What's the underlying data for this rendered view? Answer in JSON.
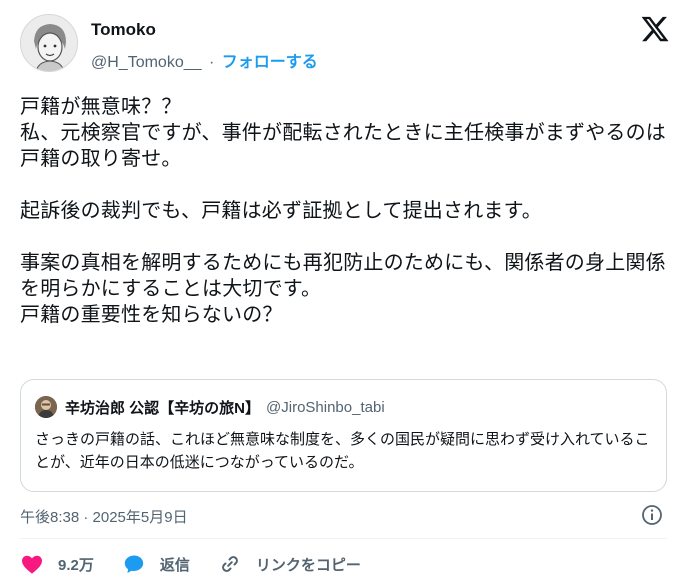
{
  "author": {
    "name": "Tomoko",
    "handle": "@H_Tomoko__",
    "separator": "·",
    "follow_label": "フォローする"
  },
  "tweet": {
    "text": "戸籍が無意味？？\n私、元検察官ですが、事件が配転されたときに主任検事がまずやるのは戸籍の取り寄せ。\n\n起訴後の裁判でも、戸籍は必ず証拠として提出されます。\n\n事案の真相を解明するためにも再犯防止のためにも、関係者の身上関係を明らかにすることは大切です。\n戸籍の重要性を知らないの？"
  },
  "quote": {
    "name": "辛坊治郎 公認【辛坊の旅N】",
    "handle": "@JiroShinbo_tabi",
    "text": "さっきの戸籍の話、これほど無意味な制度を、多くの国民が疑問に思わず受け入れていることが、近年の日本の低迷につながっているのだ。"
  },
  "timestamp": "午後8:38 · 2025年5月9日",
  "actions": {
    "like_count": "9.2万",
    "reply_label": "返信",
    "copy_link_label": "リンクをコピー"
  },
  "colors": {
    "accent": "#1d9bf0",
    "like": "#f91880",
    "muted": "#536471"
  },
  "icons": [
    "x-logo-icon",
    "info-icon",
    "heart-icon",
    "reply-bubble-icon",
    "link-icon"
  ]
}
